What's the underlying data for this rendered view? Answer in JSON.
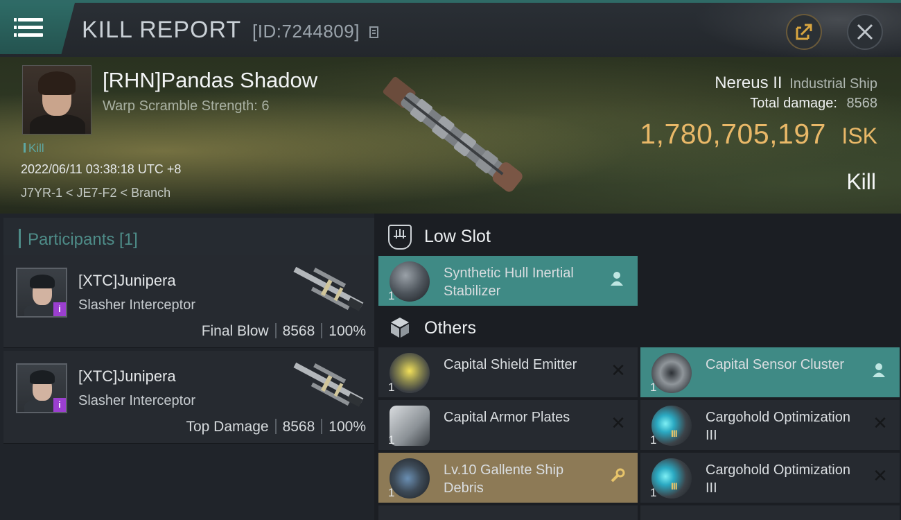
{
  "header": {
    "title": "KILL REPORT",
    "report_id": "[ID:7244809]"
  },
  "victim": {
    "name": "[RHN]Pandas Shadow",
    "subtitle": "Warp Scramble Strength: 6",
    "tag": "Kill",
    "timestamp": "2022/06/11 03:38:18 UTC +8",
    "location": "J7YR-1 < JE7-F2 < Branch",
    "ship_name": "Nereus II",
    "ship_class": "Industrial Ship",
    "damage_label": "Total damage:",
    "damage_value": "8568",
    "isk_value": "1,780,705,197",
    "isk_unit": "ISK",
    "result": "Kill"
  },
  "participants": {
    "header": "Participants [1]",
    "items": [
      {
        "name": "[XTC]Junipera",
        "ship": "Slasher Interceptor",
        "role": "Final Blow",
        "damage": "8568",
        "percent": "100%"
      },
      {
        "name": "[XTC]Junipera",
        "ship": "Slasher Interceptor",
        "role": "Top Damage",
        "damage": "8568",
        "percent": "100%"
      }
    ]
  },
  "sections": {
    "low_slot": "Low Slot",
    "others": "Others"
  },
  "items": {
    "low": [
      {
        "name": "Synthetic Hull Inertial Stabilizer",
        "qty": "1"
      }
    ],
    "others": [
      {
        "name": "Capital Shield Emitter",
        "qty": "1"
      },
      {
        "name": "Capital Sensor Cluster",
        "qty": "1"
      },
      {
        "name": "Capital Armor Plates",
        "qty": "1"
      },
      {
        "name": "Cargohold Optimization III",
        "qty": "1"
      },
      {
        "name": "Lv.10 Gallente Ship Debris",
        "qty": "1"
      },
      {
        "name": "Cargohold Optimization III",
        "qty": "1"
      }
    ]
  },
  "icons": {
    "menu": "hamburger-menu-icon",
    "copy": "copy-icon",
    "share": "share-icon",
    "close": "close-icon",
    "person": "person-icon",
    "wrench": "wrench-icon",
    "remove": "x-icon"
  },
  "colors": {
    "accent_teal": "#3f8a85",
    "isk_gold": "#e9b868",
    "item_gold": "#8d7a56",
    "badge_purple": "#9b3fcf"
  }
}
